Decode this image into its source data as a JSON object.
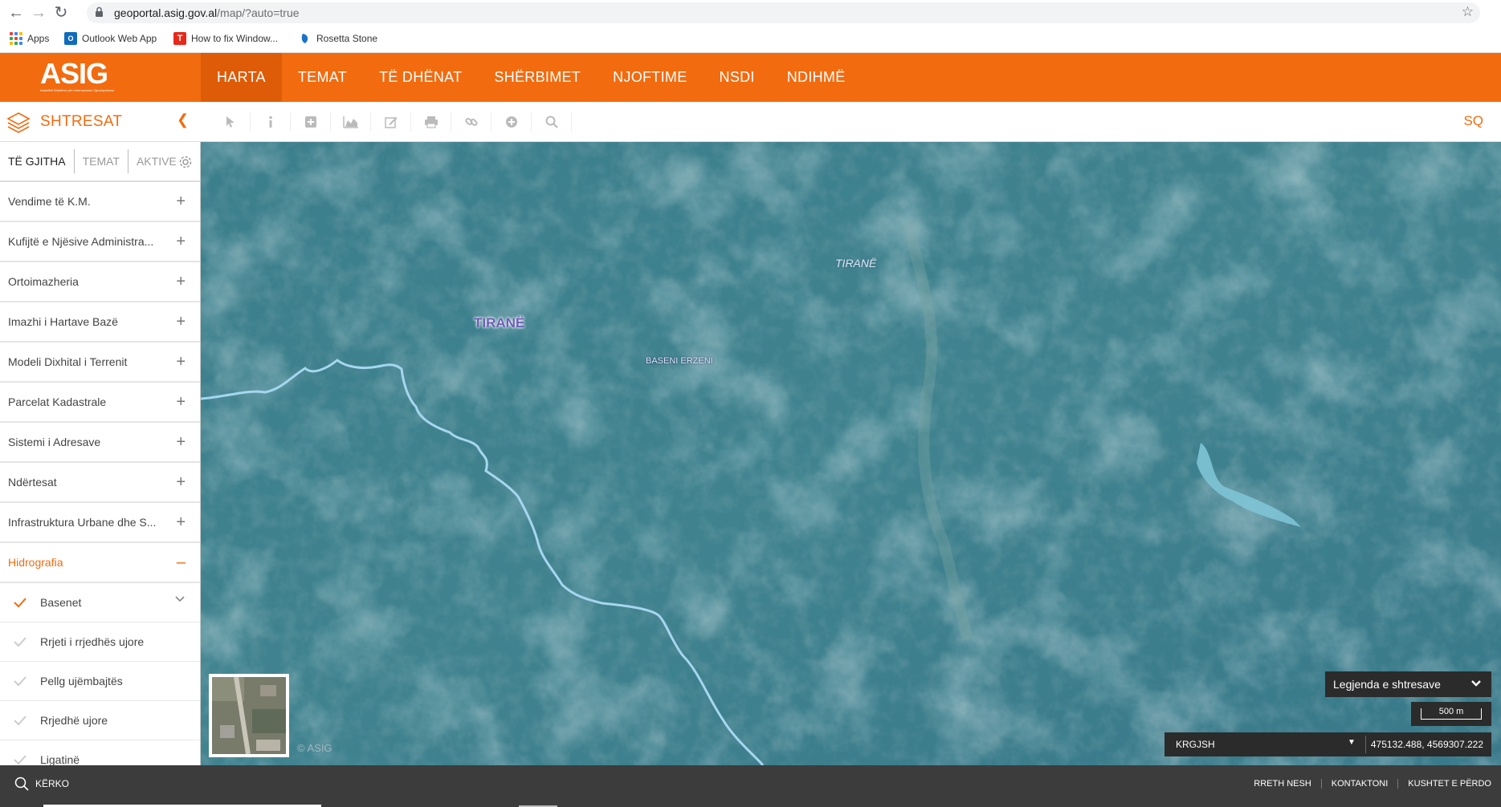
{
  "browser": {
    "url_host": "geoportal.asig.gov.al",
    "url_path": "/map/?auto=true",
    "bookmarks": [
      {
        "label": "Apps",
        "icon": "apps-grid-icon"
      },
      {
        "label": "Outlook Web App",
        "icon": "outlook-icon"
      },
      {
        "label": "How to fix Window...",
        "icon": "t-icon"
      },
      {
        "label": "Rosetta Stone",
        "icon": "rosetta-icon"
      }
    ]
  },
  "header": {
    "logo": "ASIG",
    "logo_tagline": "Autoriteti Shtetëror për Informacionin Gjeohapësinor",
    "menu": [
      "HARTA",
      "TEMAT",
      "TË DHËNAT",
      "SHËRBIMET",
      "NJOFTIME",
      "NSDI",
      "NDIHMË"
    ],
    "active_index": 0,
    "accent": "#f26b0f"
  },
  "toolbar": {
    "panel_title": "SHTRESAT",
    "language": "SQ",
    "tools": [
      "pointer-icon",
      "info-icon",
      "add-icon",
      "profile-chart-icon",
      "edit-icon",
      "print-icon",
      "link-icon",
      "location-icon",
      "zoom-icon"
    ]
  },
  "sidebar": {
    "tabs": [
      "TË GJITHA",
      "TEMAT",
      "AKTIVE"
    ],
    "categories": [
      "Vendime të K.M.",
      "Kufijtë e Njësive Administra...",
      "Ortoimazheria",
      "Imazhi i Hartave Bazë",
      "Modeli Dixhital i Terrenit",
      "Parcelat Kadastrale",
      "Sistemi i Adresave",
      "Ndërtesat",
      "Infrastruktura Urbane dhe S...",
      "Hidrografia"
    ],
    "open_category": "Hidrografia",
    "sublayers": [
      {
        "label": "Basenet",
        "active": true
      },
      {
        "label": "Rrjeti i rrjedhës ujore",
        "active": false
      },
      {
        "label": "Pellg ujëmbajtës",
        "active": false
      },
      {
        "label": "Rrjedhë ujore",
        "active": false
      },
      {
        "label": "Ligatinë",
        "active": false
      }
    ]
  },
  "map": {
    "labels": {
      "tirane_main": "TIRANË",
      "tirane_secondary": "TIRANË",
      "basin": "BASENI ERZENI"
    },
    "copyright": "© ASIG",
    "legend_button": "Legjenda e shtresave",
    "scale": "500 m",
    "crs": "KRGJSH",
    "coordinates": "475132.488, 4569307.222"
  },
  "footer": {
    "search": "KËRKO",
    "links": [
      "RRETH NESH",
      "KONTAKTONI",
      "KUSHTET E PËRDO"
    ]
  }
}
